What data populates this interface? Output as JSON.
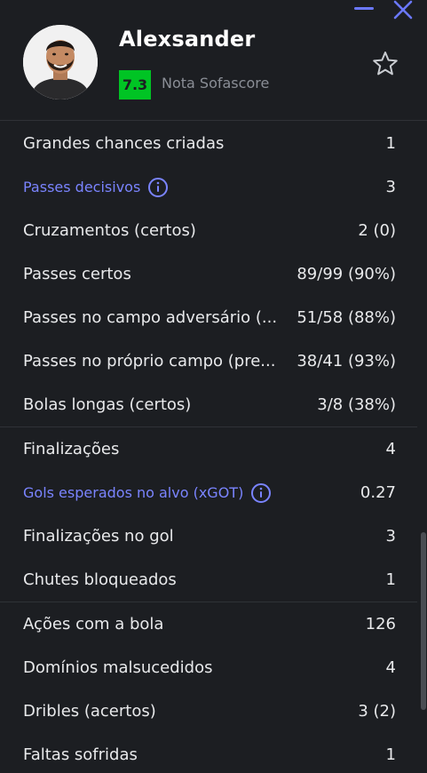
{
  "colors": {
    "background": "#1c1e22",
    "accent": "#6b78ff",
    "link": "#7a84ff",
    "rating_good": "#00c424",
    "divider": "#2f3237"
  },
  "window": {
    "minimize_icon": "minimize-icon",
    "close_icon": "close-icon"
  },
  "player": {
    "name": "Alexsander",
    "rating": "7.3",
    "rating_label": "Nota Sofascore",
    "favorite_icon": "star-outline-icon"
  },
  "groups": [
    {
      "rows": [
        {
          "label": "Grandes chances criadas",
          "value": "1"
        },
        {
          "label": "Passes decisivos",
          "value": "3",
          "link": true,
          "info_icon": "info-icon"
        },
        {
          "label": "Cruzamentos (certos)",
          "value": "2 (0)"
        },
        {
          "label": "Passes certos",
          "value": "89/99 (90%)"
        },
        {
          "label": "Passes no campo adversário (...",
          "value": "51/58 (88%)"
        },
        {
          "label": "Passes no próprio campo (pre...",
          "value": "38/41 (93%)"
        },
        {
          "label": "Bolas longas (certos)",
          "value": "3/8 (38%)"
        }
      ]
    },
    {
      "rows": [
        {
          "label": "Finalizações",
          "value": "4"
        },
        {
          "label": "Gols esperados no alvo (xGOT)",
          "value": "0.27",
          "link": true,
          "info_icon": "info-icon"
        },
        {
          "label": "Finalizações no gol",
          "value": "3"
        },
        {
          "label": "Chutes bloqueados",
          "value": "1"
        }
      ]
    },
    {
      "rows": [
        {
          "label": "Ações com a bola",
          "value": "126"
        },
        {
          "label": "Domínios malsucedidos",
          "value": "4"
        },
        {
          "label": "Dribles (acertos)",
          "value": "3 (2)"
        },
        {
          "label": "Faltas sofridas",
          "value": "1"
        }
      ]
    }
  ]
}
